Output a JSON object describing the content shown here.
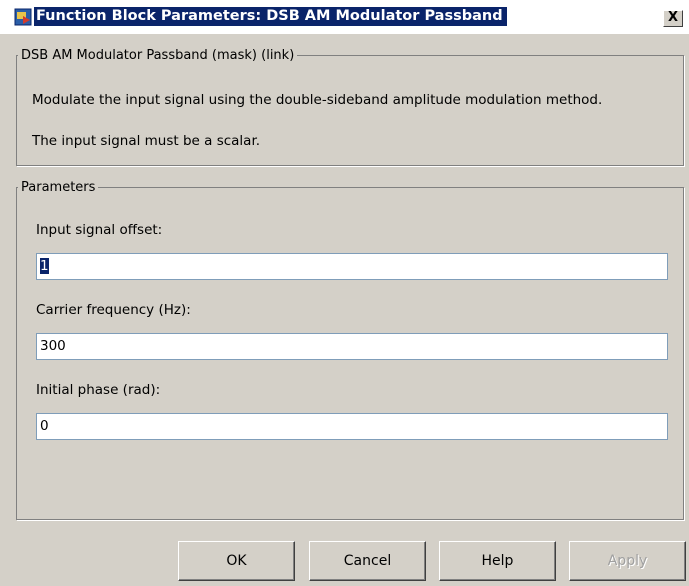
{
  "window": {
    "title": "Function Block Parameters: DSB AM Modulator Passband",
    "close_label": "X"
  },
  "description": {
    "legend": "DSB AM Modulator Passband (mask) (link)",
    "line1": "Modulate the input signal using the double-sideband amplitude modulation method.",
    "line2": "The input signal must be a scalar."
  },
  "parameters": {
    "legend": "Parameters",
    "input_signal_offset": {
      "label": "Input signal offset:",
      "value": "1"
    },
    "carrier_frequency": {
      "label": "Carrier frequency (Hz):",
      "value": "300"
    },
    "initial_phase": {
      "label": "Initial phase (rad):",
      "value": "0"
    }
  },
  "buttons": {
    "ok": "OK",
    "cancel": "Cancel",
    "help": "Help",
    "apply": "Apply"
  }
}
